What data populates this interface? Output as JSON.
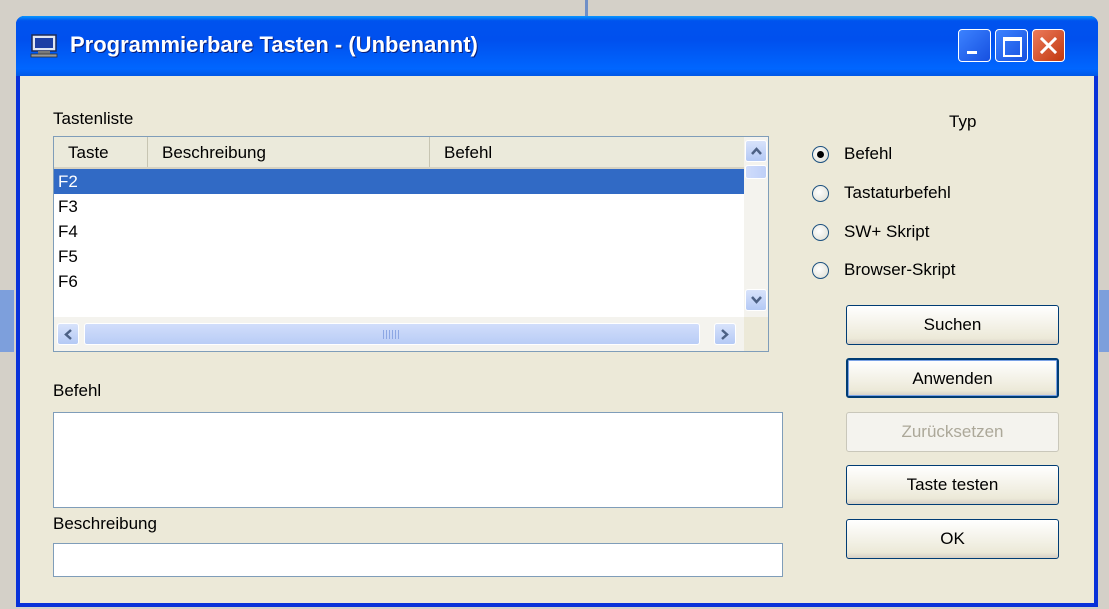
{
  "window": {
    "title": "Programmierbare Tasten - (Unbenannt)"
  },
  "key_list": {
    "label": "Tastenliste",
    "columns": [
      "Taste",
      "Beschreibung",
      "Befehl"
    ],
    "rows": [
      {
        "key": "F2",
        "description": "",
        "command": "",
        "selected": true
      },
      {
        "key": "F3",
        "description": "",
        "command": ""
      },
      {
        "key": "F4",
        "description": "",
        "command": ""
      },
      {
        "key": "F5",
        "description": "",
        "command": ""
      },
      {
        "key": "F6",
        "description": "",
        "command": ""
      }
    ]
  },
  "command_field": {
    "label": "Befehl",
    "value": ""
  },
  "description_field": {
    "label": "Beschreibung",
    "value": ""
  },
  "type_group": {
    "label": "Typ",
    "options": [
      "Befehl",
      "Tastaturbefehl",
      "SW+ Skript",
      "Browser-Skript"
    ],
    "selected": "Befehl"
  },
  "buttons": {
    "search": "Suchen",
    "apply": "Anwenden",
    "reset": "Zurücksetzen",
    "test_key": "Taste testen",
    "ok": "OK"
  },
  "colors": {
    "titlebar": "#0054e3",
    "selection": "#316ac5",
    "close_button": "#d8522b"
  },
  "icons": [
    "computer-icon",
    "minimize-icon",
    "maximize-icon",
    "close-icon",
    "scroll-up-icon",
    "scroll-down-icon",
    "scroll-left-icon",
    "scroll-right-icon"
  ]
}
